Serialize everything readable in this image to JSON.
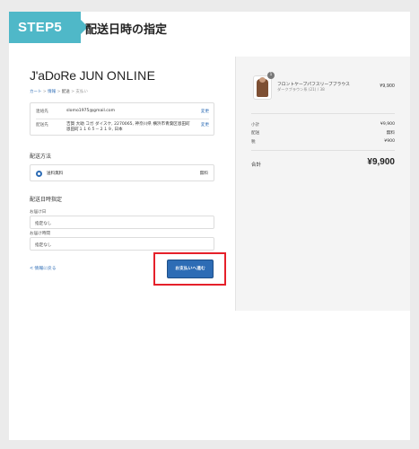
{
  "header": {
    "step_label": "STEP5",
    "title": "配送日時の指定"
  },
  "store": {
    "logo_main": "J'aDoRe JUN",
    "logo_sub": "ONLINE"
  },
  "breadcrumb": {
    "cart": "カート",
    "sep1": " > ",
    "info": "情報",
    "sep2": " > ",
    "shipping": "配送",
    "sep3": " > ",
    "payment": "支払い"
  },
  "contact": {
    "contact_label": "連絡先",
    "contact_value": "slomo1975@gmail.com",
    "ship_to_label": "配送先",
    "ship_to_line1": "吉賀 大助 コガ ダイスケ, 2270065, 神奈川県 横浜市青葉区恩田町",
    "ship_to_line2": "恩田町１１６５－２１９, 日本",
    "change": "変更"
  },
  "shipping_method": {
    "title": "配送方法",
    "option_label": "送料無料",
    "option_price": "無料"
  },
  "delivery": {
    "title": "配送日時指定",
    "date_label": "お届け日",
    "date_value": "指定なし",
    "time_label": "お届け時間",
    "time_value": "指定なし"
  },
  "actions": {
    "back": "< 情報に戻る",
    "continue": "お支払いへ進む"
  },
  "summary": {
    "qty": "1",
    "product_name": "フロントケーブパフスリーブブラウス",
    "product_variant": "ダークブラウン系 (21) / 38",
    "product_price": "¥9,900",
    "subtotal_label": "小計",
    "subtotal_value": "¥9,900",
    "shipping_label": "配送",
    "shipping_value": "無料",
    "tax_label": "税",
    "tax_value": "¥900",
    "total_label": "合計",
    "total_value": "¥9,900"
  },
  "colors": {
    "step_tag": "#4fb8c8",
    "accent": "#2d6cb5",
    "highlight": "#e5202a"
  }
}
